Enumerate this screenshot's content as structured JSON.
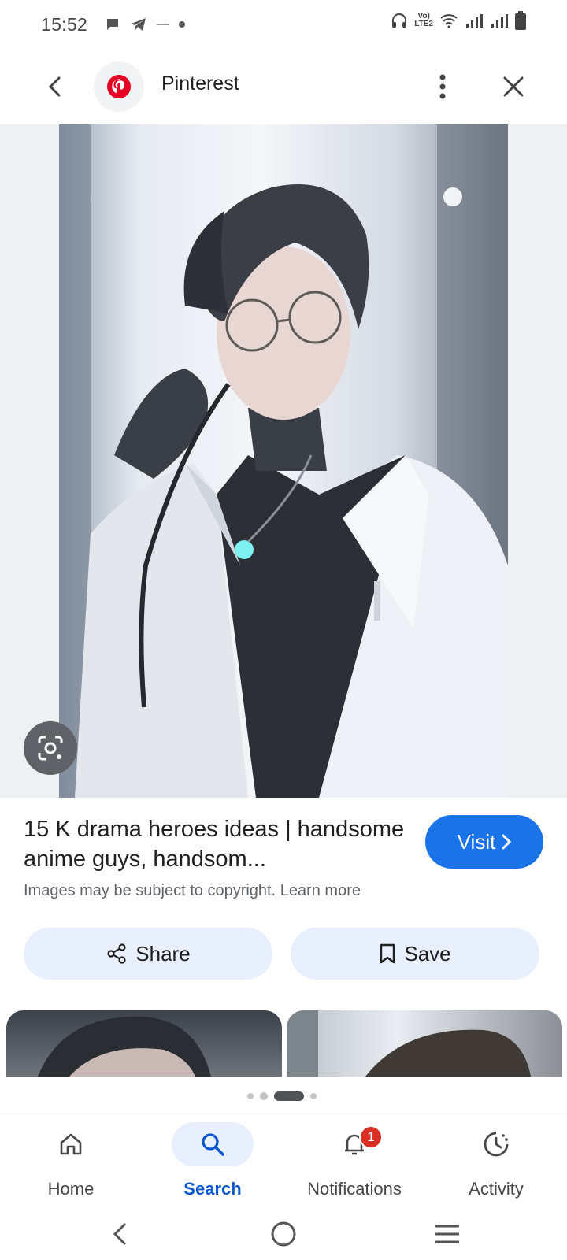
{
  "status_bar": {
    "time": "15:52",
    "network_label": "LTE2",
    "volte_label": "Vo)",
    "icons": [
      "chat-bubble-icon",
      "telegram-icon",
      "wifi-dot-icon",
      "dot-icon",
      "headphones-icon",
      "wifi-icon",
      "signal-icon",
      "signal-icon",
      "battery-icon"
    ]
  },
  "header": {
    "back_icon": "chevron-left-icon",
    "site_name": "Pinterest",
    "site_logo": "pinterest-logo-icon",
    "more_icon": "more-vert-icon",
    "close_icon": "close-icon",
    "accent": "#e60023"
  },
  "image": {
    "description_icon": "google-lens-icon"
  },
  "result": {
    "title": "15 K drama heroes ideas | handsome anime guys, handsom...",
    "visit_label": "Visit",
    "copyright_text": "Images may be subject to copyright.",
    "learn_more": "Learn more"
  },
  "actions": {
    "share_label": "Share",
    "save_label": "Save"
  },
  "pager": {
    "count": 4,
    "active_index": 2
  },
  "bottom_nav": {
    "items": [
      {
        "label": "Home",
        "icon": "home-icon",
        "active": false
      },
      {
        "label": "Search",
        "icon": "search-icon",
        "active": true
      },
      {
        "label": "Notifications",
        "icon": "bell-icon",
        "active": false,
        "badge": "1"
      },
      {
        "label": "Activity",
        "icon": "activity-icon",
        "active": false
      }
    ]
  },
  "colors": {
    "primary_blue": "#1a73e8",
    "active_nav": "#0b57d0",
    "pill_bg": "#e8f0fe",
    "badge_red": "#d93025"
  }
}
